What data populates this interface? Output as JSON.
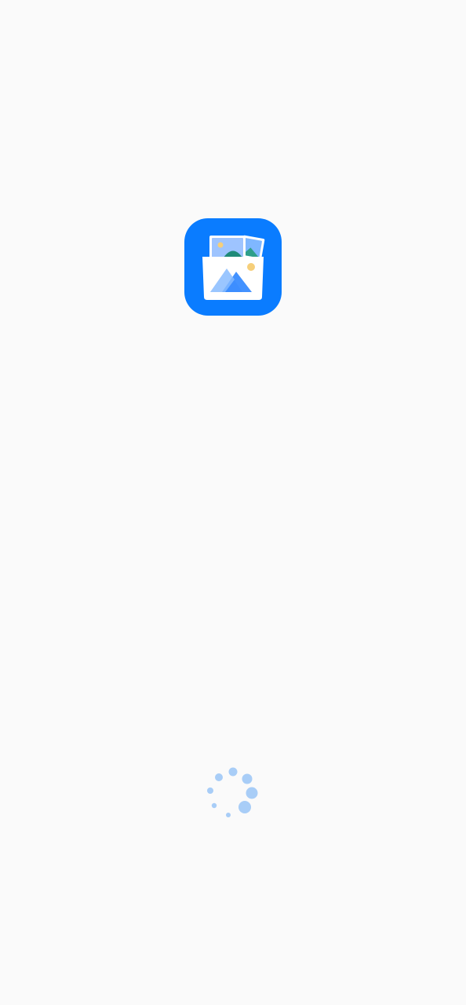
{
  "app": {
    "icon_name": "gallery-app-icon",
    "brand_color": "#0a7cff",
    "accent_sun_color": "#f6cf7a",
    "pocket_color": "#ffffff"
  },
  "loading": {
    "icon_name": "loading-spinner-icon",
    "dot_color": "#a8cdf7"
  }
}
